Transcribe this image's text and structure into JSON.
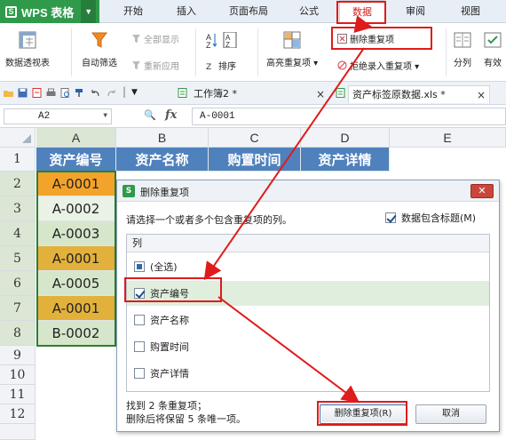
{
  "app": {
    "name": "WPS 表格",
    "logo": "S"
  },
  "menu": {
    "tabs": [
      {
        "label": "开始"
      },
      {
        "label": "插入"
      },
      {
        "label": "页面布局"
      },
      {
        "label": "公式"
      },
      {
        "label": "数据"
      },
      {
        "label": "审阅"
      },
      {
        "label": "视图"
      }
    ],
    "active_tab": "数据"
  },
  "ribbon": {
    "pivot_table": "数据透视表",
    "auto_filter": "自动筛选",
    "show_all": "全部显示",
    "reapply": "重新应用",
    "sort": "排序",
    "highlight_duplicates": "高亮重复项",
    "delete_duplicates": "删除重复项",
    "reject_duplicates": "拒绝录入重复项",
    "split": "分列",
    "validity": "有效"
  },
  "doc_tabs": [
    {
      "label": "工作簿2 *"
    },
    {
      "label": "资产标签原数据.xls *"
    }
  ],
  "formula_bar": {
    "name_box": "A2",
    "fx": "fx",
    "value": "A-0001"
  },
  "sheet": {
    "columns": [
      "A",
      "B",
      "C",
      "D",
      "E"
    ],
    "rows": [
      "1",
      "2",
      "3",
      "4",
      "5",
      "6",
      "7",
      "8",
      "9",
      "10",
      "11",
      "12"
    ],
    "headers": [
      "资产编号",
      "资产名称",
      "购置时间",
      "资产详情"
    ],
    "col_a": [
      {
        "value": "A-0001",
        "fill": "#f4a32a"
      },
      {
        "value": "A-0002",
        "fill": "#e9f2e4"
      },
      {
        "value": "A-0003",
        "fill": "#d6e6cb"
      },
      {
        "value": "A-0001",
        "fill": "#e2b13c"
      },
      {
        "value": "A-0005",
        "fill": "#d6e6cb"
      },
      {
        "value": "A-0001",
        "fill": "#e2b13c"
      },
      {
        "value": "B-0002",
        "fill": "#d6e6cb"
      }
    ]
  },
  "dialog": {
    "title": "删除重复项",
    "instruction": "请选择一个或者多个包含重复项的列。",
    "has_header_label": "数据包含标题(M)",
    "has_header_checked": true,
    "list_header": "列",
    "items": [
      {
        "label": "(全选)",
        "state": "partial"
      },
      {
        "label": "资产编号",
        "state": "checked"
      },
      {
        "label": "资产名称",
        "state": "unchecked"
      },
      {
        "label": "购置时间",
        "state": "unchecked"
      },
      {
        "label": "资产详情",
        "state": "unchecked"
      }
    ],
    "found_line1": "找到 2 条重复项；",
    "found_line2": "删除后将保留 5 条唯一项。",
    "delete_button": "删除重复项(R)",
    "cancel_button": "取消"
  },
  "colors": {
    "app_green": "#2f9a4a",
    "header_blue": "#4f81bd",
    "highlight_red": "#e01b1b",
    "active_tab_red": "#d21f1f"
  }
}
